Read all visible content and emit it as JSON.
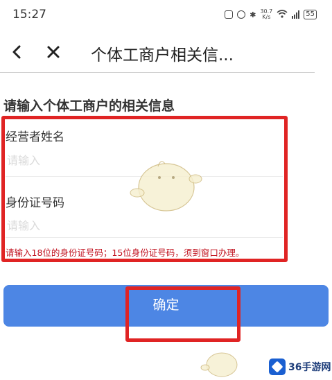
{
  "status_bar": {
    "time": "15:27",
    "net_speed_value": "30.7",
    "net_speed_unit": "K/s",
    "battery": "55"
  },
  "nav": {
    "title": "个体工商户相关信...",
    "back_icon": "chevron-left-icon",
    "close_icon": "close-icon"
  },
  "form": {
    "section_title": "请输入个体工商户的相关信息",
    "operator_name": {
      "label": "经营者姓名",
      "placeholder": "请输入",
      "value": ""
    },
    "id_number": {
      "label": "身份证号码",
      "placeholder": "请输入",
      "value": ""
    },
    "hint": "请输入18位的身份证号码；15位身份证号码，须到窗口办理。"
  },
  "confirm_button": {
    "label": "确定",
    "color": "#4d86e4"
  },
  "annotation_color": "#e02424",
  "watermark": {
    "text": "36手游网"
  }
}
